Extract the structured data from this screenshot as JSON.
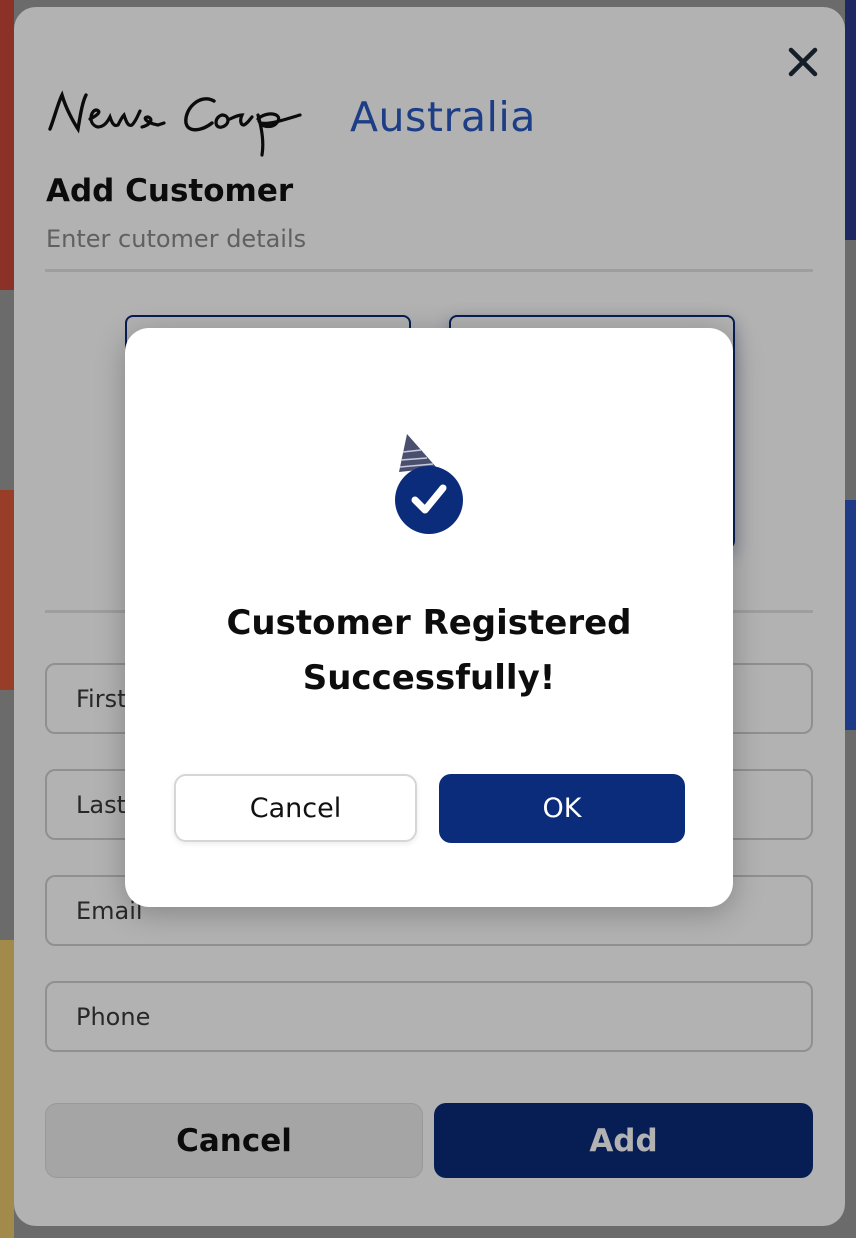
{
  "brand": {
    "script_name": "News Corp",
    "region": "Australia"
  },
  "form": {
    "title": "Add Customer",
    "subtitle": "Enter cutomer details",
    "fields": {
      "first_name_placeholder": "First Name",
      "last_name_placeholder": "Last Name",
      "email_placeholder": "Email",
      "phone_placeholder": "Phone"
    },
    "cancel_label": "Cancel",
    "add_label": "Add"
  },
  "dialog": {
    "line1": "Customer Registered",
    "line2": "Successfully!",
    "cancel_label": "Cancel",
    "ok_label": "OK"
  },
  "icons": {
    "close": "close-icon",
    "success": "check-circle-icon"
  },
  "colors": {
    "primary": "#0b2c7a",
    "brand_blue": "#2a59c0",
    "overlay": "rgba(0,0,0,0.30)"
  }
}
